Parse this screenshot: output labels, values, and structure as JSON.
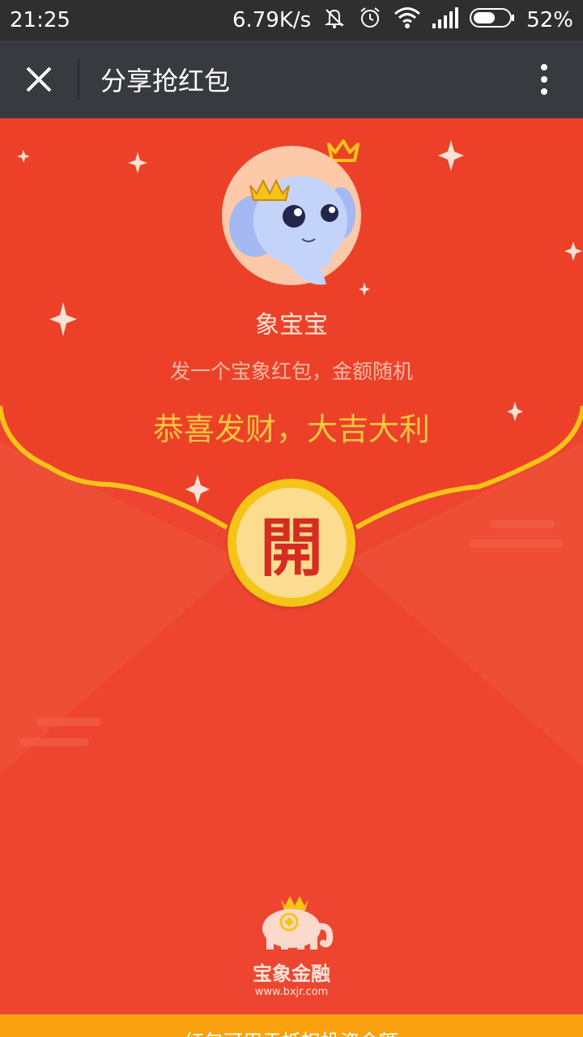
{
  "status_bar": {
    "time": "21:25",
    "speed": "6.79K/s",
    "battery": "52%",
    "icons": [
      "mute-icon",
      "alarm-icon",
      "wifi-icon",
      "signal-icon",
      "battery-icon"
    ]
  },
  "header": {
    "title": "分享抢红包",
    "close_icon": "close-icon",
    "more_icon": "more-vertical-icon"
  },
  "envelope": {
    "sender_name": "象宝宝",
    "subtitle": "发一个宝象红包，金额随机",
    "greeting": "恭喜发财，大吉大利",
    "open_label": "開"
  },
  "brand": {
    "name": "宝象金融",
    "url": "www.bxjr.com"
  },
  "footer": {
    "text": "红包可用于抵扣投资金额"
  },
  "colors": {
    "envelope_red": "#ed4530",
    "envelope_flap": "#ec4128",
    "gold": "#f5c417",
    "greeting_gold": "#f8c640",
    "footer_orange": "#f9a10e",
    "title_bar": "#393a3f"
  }
}
